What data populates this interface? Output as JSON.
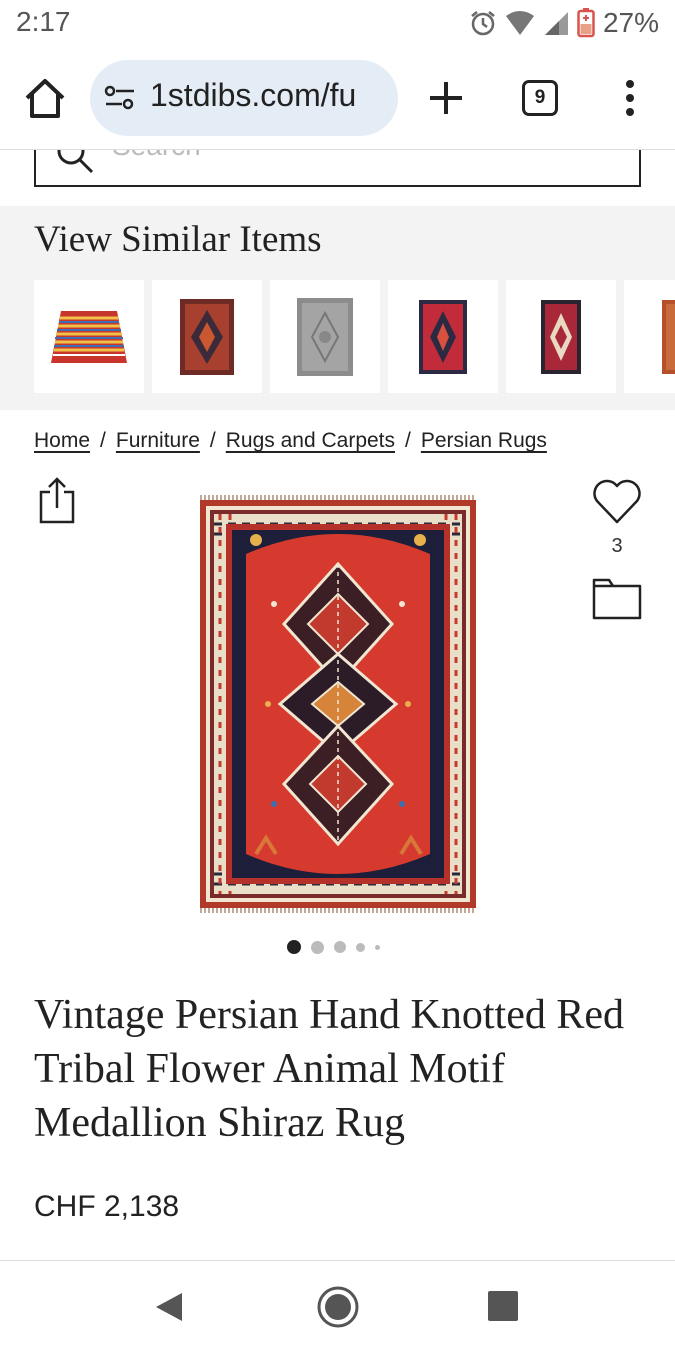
{
  "status": {
    "time": "2:17",
    "battery": "27%"
  },
  "browser": {
    "url": "1stdibs.com/fu",
    "tab_count": "9"
  },
  "search": {
    "placeholder": "Search"
  },
  "similar": {
    "title": "View Similar Items",
    "items": [
      "striped-gabbeh-rug",
      "dark-red-medallion-rug",
      "grey-vintage-rug",
      "red-medallion-rug",
      "red-medallion-rug-2",
      "rust-rug-partial"
    ]
  },
  "breadcrumb": {
    "items": [
      "Home",
      "Furniture",
      "Rugs and Carpets",
      "Persian Rugs"
    ],
    "separator": "/"
  },
  "product": {
    "favorite_count": "3",
    "title": "Vintage Persian Hand Knotted Red Tribal Flower Animal Motif Medallion Shiraz Rug",
    "price": "CHF 2,138",
    "image_index": 1,
    "image_total": 5
  },
  "colors": {
    "rug_red": "#d63a2e",
    "rug_navy": "#1d1f3a",
    "url_bg": "#e4ecf6",
    "section_bg": "#f3f3f3"
  }
}
